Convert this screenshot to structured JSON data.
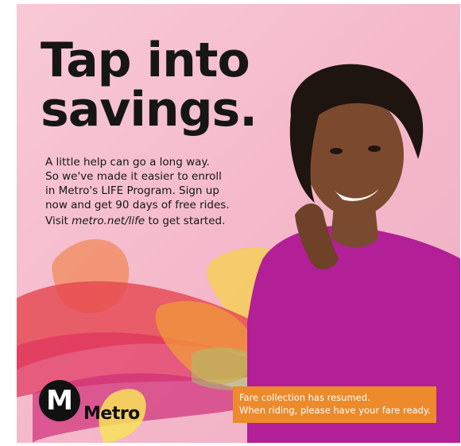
{
  "ad": {
    "headline_line1": "Tap into",
    "headline_line2": "savings.",
    "body_lines": [
      "A little help can go a long way.",
      "So we've made it easier to enroll",
      "in Metro's LIFE Program. Sign up",
      "now and get 90 days of free rides."
    ],
    "visit_prefix": "Visit ",
    "visit_link": "metro.net/life",
    "visit_suffix": " to get started.",
    "notice_line1": "Fare collection has resumed.",
    "notice_line2": "When riding, please have your fare ready."
  },
  "logo": {
    "badge_letter": "M",
    "wordmark": "Metro"
  },
  "colors": {
    "background_pink": "#f4b8ca",
    "notice_orange": "#ec8a2c",
    "shirt_magenta": "#b21f96",
    "text_dark": "#161616"
  }
}
